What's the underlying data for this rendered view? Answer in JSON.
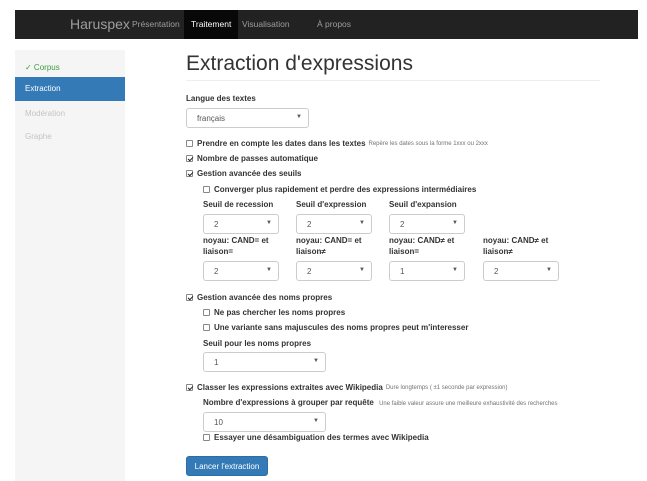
{
  "navbar": {
    "brand": "Haruspex",
    "items": [
      "Présentation",
      "Traitement",
      "Visualisation",
      "À propos"
    ]
  },
  "sidebar": {
    "items": [
      "✓ Corpus",
      "Extraction",
      "Modération",
      "Graphe"
    ]
  },
  "page": {
    "title": "Extraction d'expressions"
  },
  "form": {
    "langue_label": "Langue des textes",
    "langue_value": "français",
    "dates_label": "Prendre en compte les dates dans les textes",
    "dates_help": "Repère les dates sous la forme 1xxx ou 2xxx",
    "passes_label": "Nombre de passes automatique",
    "seuils_label": "Gestion avancée des seuils",
    "converger_label": "Converger plus rapidement et perdre des expressions intermédiaires",
    "seuil_recession_label": "Seuil de recession",
    "seuil_recession_value": "2",
    "seuil_expression_label": "Seuil d'expression",
    "seuil_expression_value": "2",
    "seuil_expansion_label": "Seuil d'expansion",
    "seuil_expansion_value": "2",
    "noyau1_label_a": "noyau: CAND= et",
    "noyau1_label_b": "liaison=",
    "noyau1_value": "2",
    "noyau2_label_a": "noyau: CAND= et",
    "noyau2_label_b": "liaison≠",
    "noyau2_value": "2",
    "noyau3_label_a": "noyau: CAND≠ et",
    "noyau3_label_b": "liaison=",
    "noyau3_value": "1",
    "noyau4_label_a": "noyau: CAND≠ et",
    "noyau4_label_b": "liaison≠",
    "noyau4_value": "2",
    "noms_propres_label": "Gestion avancée des noms propres",
    "ne_pas_chercher_label": "Ne pas chercher les noms propres",
    "variante_label": "Une variante sans majuscules des noms propres peut m'interesser",
    "seuil_noms_label": "Seuil pour les noms propres",
    "seuil_noms_value": "1",
    "wikipedia_label": "Classer les expressions extraites avec Wikipedia",
    "wikipedia_help": "Dure longtemps ( ±1 seconde par expression)",
    "nb_expr_label": "Nombre d'expressions à grouper par requête",
    "nb_expr_help": "Une faible valeur assure une meilleure exhaustivité des recherches",
    "nb_expr_value": "10",
    "desambig_label": "Essayer une désambiguation des termes avec Wikipedia",
    "submit_label": "Lancer l'extraction"
  },
  "icons": {
    "caret": "caret-down-icon",
    "check": "checkmark-icon"
  },
  "colors": {
    "navbar_bg": "#222222",
    "navbar_active_bg": "#080808",
    "primary": "#337ab7",
    "success_text": "#3c9c3c",
    "sidebar_bg": "#f5f5f5"
  }
}
